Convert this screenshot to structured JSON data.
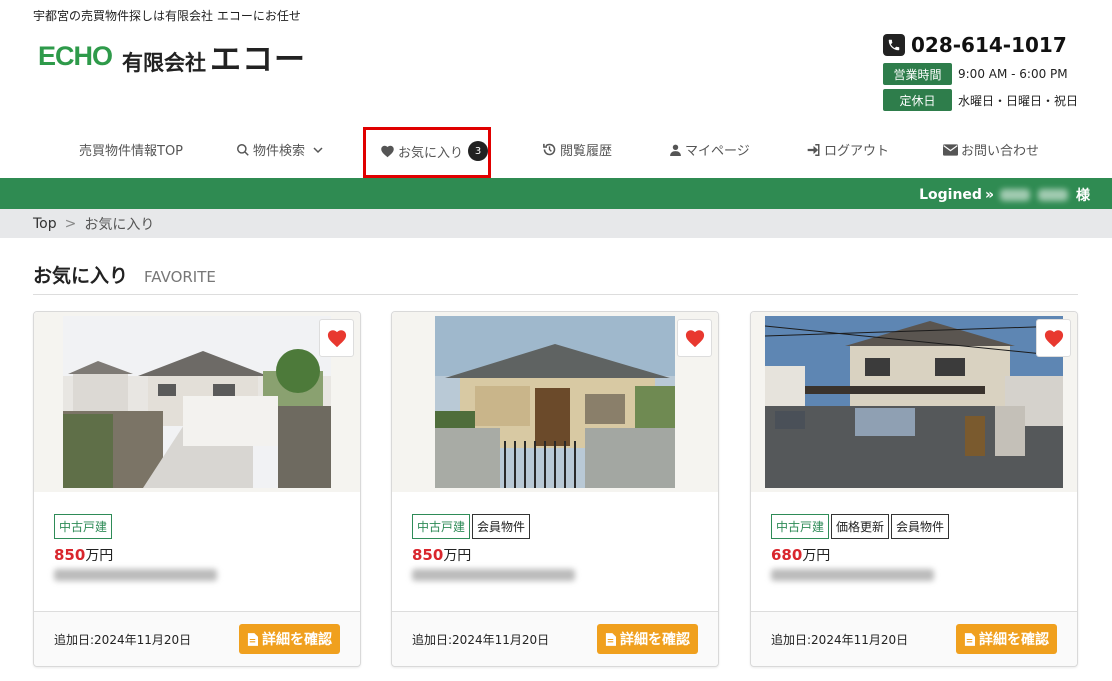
{
  "header": {
    "tagline": "宇都宮の売買物件探しは有限会社 エコーにお任せ",
    "logo_text": "ECHO",
    "company_prefix": "有限会社",
    "company_name": "エコー",
    "phone": "028-614-1017",
    "hours_label": "営業時間",
    "hours_value": "9:00 AM - 6:00 PM",
    "holiday_label": "定休日",
    "holiday_value": "水曜日・日曜日・祝日"
  },
  "nav": {
    "items": [
      {
        "label": "売買物件情報TOP"
      },
      {
        "label": "物件検索"
      },
      {
        "label": "お気に入り",
        "badge": "3"
      },
      {
        "label": "閲覧履歴"
      },
      {
        "label": "マイページ"
      },
      {
        "label": "ログアウト"
      },
      {
        "label": "お問い合わせ"
      }
    ]
  },
  "login": {
    "label": "Logined",
    "suffix": "様"
  },
  "breadcrumb": {
    "home": "Top",
    "separator": ">",
    "current": "お気に入り"
  },
  "section": {
    "title": "お気に入り",
    "subtitle": "FAVORITE"
  },
  "cards": [
    {
      "tags": [
        "中古戸建"
      ],
      "price": "850",
      "unit": "万円",
      "added": "追加日:2024年11月20日",
      "button": "詳細を確認"
    },
    {
      "tags": [
        "中古戸建",
        "会員物件"
      ],
      "price": "850",
      "unit": "万円",
      "added": "追加日:2024年11月20日",
      "button": "詳細を確認"
    },
    {
      "tags": [
        "中古戸建",
        "価格更新",
        "会員物件"
      ],
      "price": "680",
      "unit": "万円",
      "added": "追加日:2024年11月20日",
      "button": "詳細を確認"
    }
  ],
  "colors": {
    "brand_green": "#2f8b52",
    "accent_orange": "#f0a01e",
    "price_red": "#d9262d",
    "highlight_red": "#e00000"
  }
}
